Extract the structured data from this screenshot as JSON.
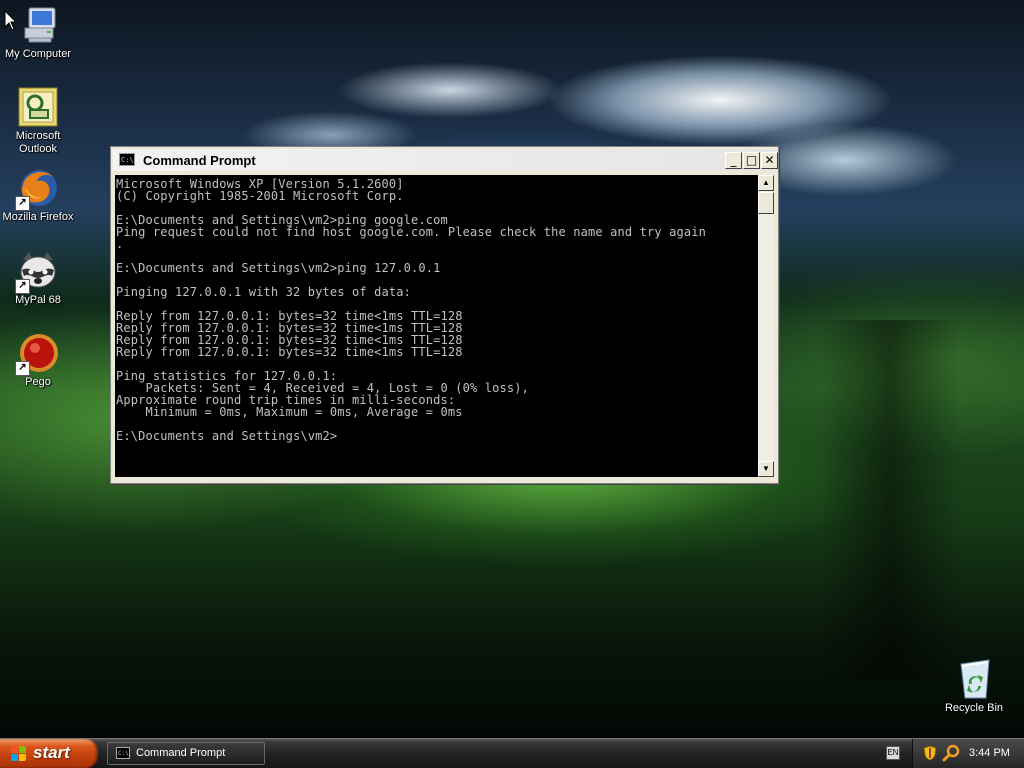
{
  "desktop": {
    "icons": [
      {
        "label": "My Computer",
        "icon": "my-computer-icon"
      },
      {
        "label": "Microsoft\nOutlook",
        "icon": "outlook-icon"
      },
      {
        "label": "Mozilla Firefox",
        "icon": "firefox-icon"
      },
      {
        "label": "MyPal 68",
        "icon": "mypal-icon"
      },
      {
        "label": "Pego",
        "icon": "pego-icon"
      },
      {
        "label": "Recycle Bin",
        "icon": "recycle-bin-icon"
      }
    ]
  },
  "cmd_window": {
    "title": "Command Prompt",
    "icon_text": "C:\\",
    "buttons": {
      "minimize": "_",
      "maximize": "□",
      "close": "✕"
    },
    "console_lines": [
      "Microsoft Windows XP [Version 5.1.2600]",
      "(C) Copyright 1985-2001 Microsoft Corp.",
      "",
      "E:\\Documents and Settings\\vm2>ping google.com",
      "Ping request could not find host google.com. Please check the name and try again",
      ".",
      "",
      "E:\\Documents and Settings\\vm2>ping 127.0.0.1",
      "",
      "Pinging 127.0.0.1 with 32 bytes of data:",
      "",
      "Reply from 127.0.0.1: bytes=32 time<1ms TTL=128",
      "Reply from 127.0.0.1: bytes=32 time<1ms TTL=128",
      "Reply from 127.0.0.1: bytes=32 time<1ms TTL=128",
      "Reply from 127.0.0.1: bytes=32 time<1ms TTL=128",
      "",
      "Ping statistics for 127.0.0.1:",
      "    Packets: Sent = 4, Received = 4, Lost = 0 (0% loss),",
      "Approximate round trip times in milli-seconds:",
      "    Minimum = 0ms, Maximum = 0ms, Average = 0ms",
      "",
      "E:\\Documents and Settings\\vm2>"
    ],
    "scroll_up": "▲",
    "scroll_down": "▼"
  },
  "taskbar": {
    "start_label": "start",
    "tasks": [
      {
        "label": "Command Prompt",
        "icon_text": "C:\\"
      }
    ],
    "language": "EN",
    "clock": "3:44 PM"
  },
  "colors": {
    "console_bg": "#000000",
    "console_fg": "#c0c0c0",
    "start_button": "#c2410c"
  }
}
